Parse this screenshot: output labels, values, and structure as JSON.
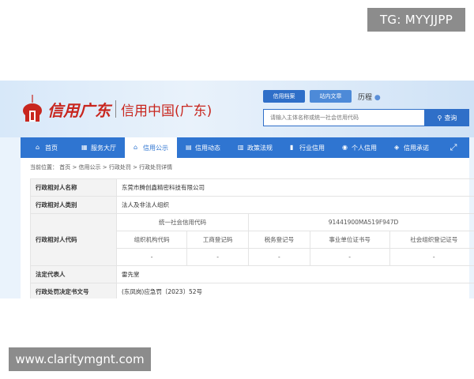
{
  "watermarks": {
    "top": "TG: MYYJJPP",
    "bottom": "www.claritymgnt.com"
  },
  "header": {
    "logo_text": "信用广东",
    "logo_sub": "信用中国(广东)",
    "tabs": [
      "信用档案",
      "站内文章"
    ],
    "mode_label": "历程",
    "search_placeholder": "请输入主体名称或统一社会信用代码",
    "search_button": "查询"
  },
  "nav": {
    "items": [
      {
        "label": "首页",
        "icon": "home-icon",
        "glyph": "⌂"
      },
      {
        "label": "服务大厅",
        "icon": "grid-icon",
        "glyph": "▦"
      },
      {
        "label": "信用公示",
        "icon": "bank-icon",
        "glyph": "⌂",
        "active": true
      },
      {
        "label": "信用动态",
        "icon": "news-icon",
        "glyph": "▤"
      },
      {
        "label": "政策法规",
        "icon": "book-icon",
        "glyph": "▥"
      },
      {
        "label": "行业信用",
        "icon": "chart-icon",
        "glyph": "▮"
      },
      {
        "label": "个人信用",
        "icon": "person-icon",
        "glyph": "◉"
      },
      {
        "label": "信用承诺",
        "icon": "shield-icon",
        "glyph": "◈"
      }
    ],
    "expand_glyph": "⤢"
  },
  "breadcrumb": "当前位置： 首页 > 信用公示 > 行政处罚 > 行政处罚详情",
  "detail": {
    "name_label": "行政相对人名称",
    "name_value": "东莞市腾创鑫精密科技有限公司",
    "category_label": "行政相对人类别",
    "category_value": "法人及非法人组织",
    "code_label": "行政相对人代码",
    "usc_label": "统一社会信用代码",
    "usc_value": "91441900MA519F947D",
    "sub_headers": [
      "组织机构代码",
      "工商登记码",
      "税务登记号",
      "事业单位证书号",
      "社会组织登记证号"
    ],
    "sub_values": [
      "-",
      "-",
      "-",
      "-",
      "-"
    ],
    "legal_label": "法定代表人",
    "legal_value": "雷先堂",
    "decision_label": "行政处罚决定书文号",
    "decision_value": "(东凤岗)应急罚〔2023〕52号"
  }
}
